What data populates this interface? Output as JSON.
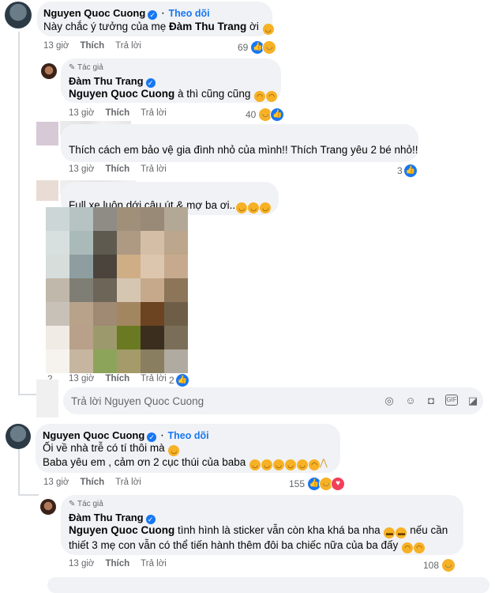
{
  "comments": [
    {
      "author": "Nguyen Quoc Cuong",
      "follow": "Theo dõi",
      "text": "Này chắc ý tưởng của mẹ",
      "tag": "Đàm Thu Trang",
      "text_after": "ời",
      "time": "13 giờ",
      "like": "Thích",
      "reply": "Trả lời",
      "reaction_count": "69"
    },
    {
      "badge": "Tác giả",
      "author": "Đàm Thu Trang",
      "tag": "Nguyen Quoc Cuong",
      "text_after": "à thì cũng cũng",
      "time": "13 giờ",
      "like": "Thích",
      "reply": "Trả lời",
      "reaction_count": "40"
    },
    {
      "text": "Thích cách em bảo vệ gia đình nhỏ của mình!! Thích Trang yêu 2 bé nhỏ!!",
      "time": "13 giờ",
      "like": "Thích",
      "reply": "Trả lời",
      "reaction_count": "3"
    },
    {
      "text": "Full xe luôn dới cậu út & mợ ba ơi..",
      "time": "13 giờ",
      "like": "Thích",
      "reply": "Trả lời",
      "reaction_count": "2",
      "reaction_count2": "2"
    },
    {
      "author": "Nguyen Quoc Cuong",
      "follow": "Theo dõi",
      "line1": "Ối về nhà trễ có tí thôi mà",
      "line2": "Baba yêu em , cảm ơn 2 cục thúi của baba",
      "time": "13 giờ",
      "like": "Thích",
      "reply": "Trả lời",
      "reaction_count": "155"
    },
    {
      "badge": "Tác giả",
      "author": "Đàm Thu Trang",
      "tag": "Nguyen Quoc Cuong",
      "text_after": "tình hình là sticker vẫn còn kha khá ba nha",
      "text_after2": "nếu cần",
      "line2": "thiết 3 mẹ con vẫn có thể tiến hành thêm đôi ba chiếc nữa của ba đấy",
      "time": "13 giờ",
      "like": "Thích",
      "reply": "Trả lời",
      "reaction_count": "108"
    }
  ],
  "reply_box": {
    "placeholder": "Trả lời Nguyen Quoc Cuong"
  },
  "colors": {
    "accent": "#1877f2",
    "bubble": "#f0f2f5",
    "meta": "#65676b"
  }
}
